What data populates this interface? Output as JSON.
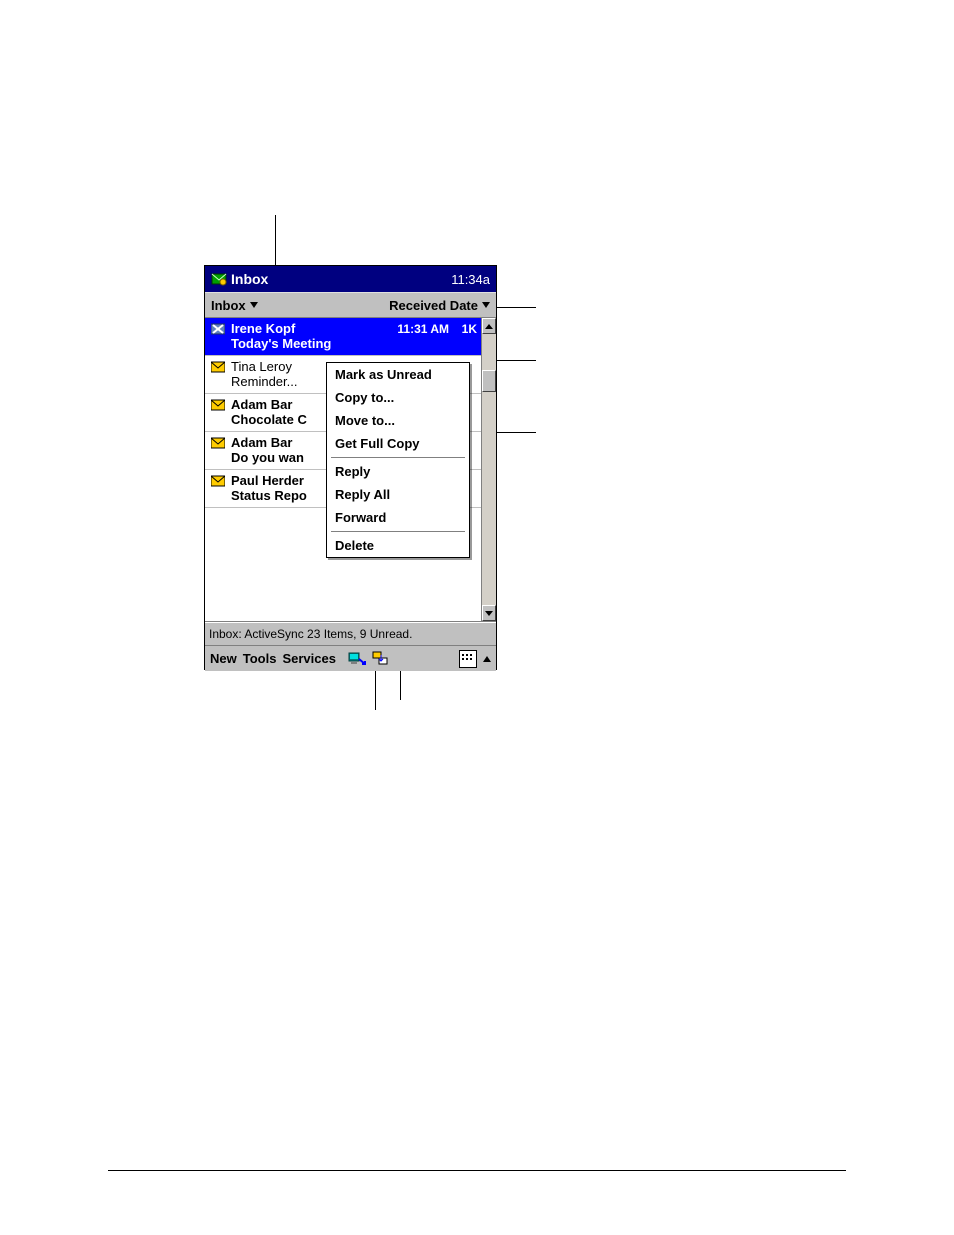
{
  "titlebar": {
    "app_label": "Inbox",
    "clock": "11:34a"
  },
  "filterbar": {
    "folder_label": "Inbox",
    "sort_label": "Received Date"
  },
  "messages": [
    {
      "sender": "Irene Kopf",
      "time": "11:31 AM",
      "size": "1K",
      "subject": "Today's Meeting",
      "selected": true,
      "unread": true,
      "icon": "blocked"
    },
    {
      "sender": "Tina Leroy",
      "time": "",
      "size": "",
      "subject": "Reminder...",
      "selected": false,
      "unread": false,
      "icon": "envelope"
    },
    {
      "sender": "Adam Bar",
      "time": "",
      "size": "",
      "subject": "Chocolate C",
      "selected": false,
      "unread": true,
      "icon": "envelope"
    },
    {
      "sender": "Adam Bar",
      "time": "",
      "size": "",
      "subject": "Do you wan",
      "selected": false,
      "unread": true,
      "icon": "envelope"
    },
    {
      "sender": "Paul Herder",
      "time": "",
      "size": "",
      "subject": "Status Repo",
      "selected": false,
      "unread": true,
      "icon": "envelope"
    }
  ],
  "context_menu": {
    "items": [
      "Mark as Unread",
      "Copy to...",
      "Move to...",
      "Get Full Copy",
      "-",
      "Reply",
      "Reply All",
      "Forward",
      "-",
      "Delete"
    ]
  },
  "status": {
    "text": "Inbox: ActiveSync  23 Items, 9 Unread."
  },
  "bottombar": {
    "new_label": "New",
    "tools_label": "Tools",
    "services_label": "Services"
  }
}
